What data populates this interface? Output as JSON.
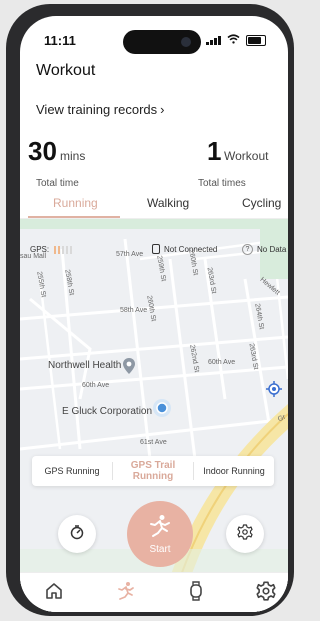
{
  "status_bar": {
    "time": "11:11"
  },
  "header": {
    "title": "Workout",
    "records_link": "View training records",
    "records_chevron": "›"
  },
  "stats": {
    "time_value": "30",
    "time_unit": "mins",
    "time_label": "Total time",
    "count_value": "1",
    "count_unit": "Workout",
    "count_label": "Total times"
  },
  "tabs": [
    {
      "label": "Running"
    },
    {
      "label": "Walking"
    },
    {
      "label": "Cycling"
    }
  ],
  "gps": {
    "label": "GPS:",
    "watch_status": "Not Connected",
    "data_status": "No Data",
    "help_glyph": "?"
  },
  "map": {
    "streets": [
      "57th Ave",
      "58th Ave",
      "60th Ave",
      "60th Ave",
      "61st Ave",
      "255th St",
      "258th St",
      "259th St",
      "260th St",
      "260th St",
      "262nd St",
      "263rd St",
      "263rd St",
      "264th St",
      "Hewlett",
      "Gr",
      "sau Mall"
    ],
    "poi": [
      {
        "name": "Northwell Health"
      },
      {
        "name": "E Gluck Corporation"
      }
    ]
  },
  "running_modes": [
    {
      "label": "GPS Running",
      "active": false
    },
    {
      "label": "GPS Trail Running",
      "active": true
    },
    {
      "label": "Indoor Running",
      "active": false
    }
  ],
  "actions": {
    "start_label": "Start",
    "left_icon": "stopwatch-icon",
    "right_icon": "gear-icon"
  },
  "bottom_nav": [
    {
      "icon": "home-icon"
    },
    {
      "icon": "running-icon"
    },
    {
      "icon": "watch-icon"
    },
    {
      "icon": "settings-icon"
    }
  ],
  "colors": {
    "accent": "#e8b2a3",
    "accent_text": "#d9a99a",
    "map_bg": "#eef0f3",
    "poi_pin": "#4a90d9"
  }
}
